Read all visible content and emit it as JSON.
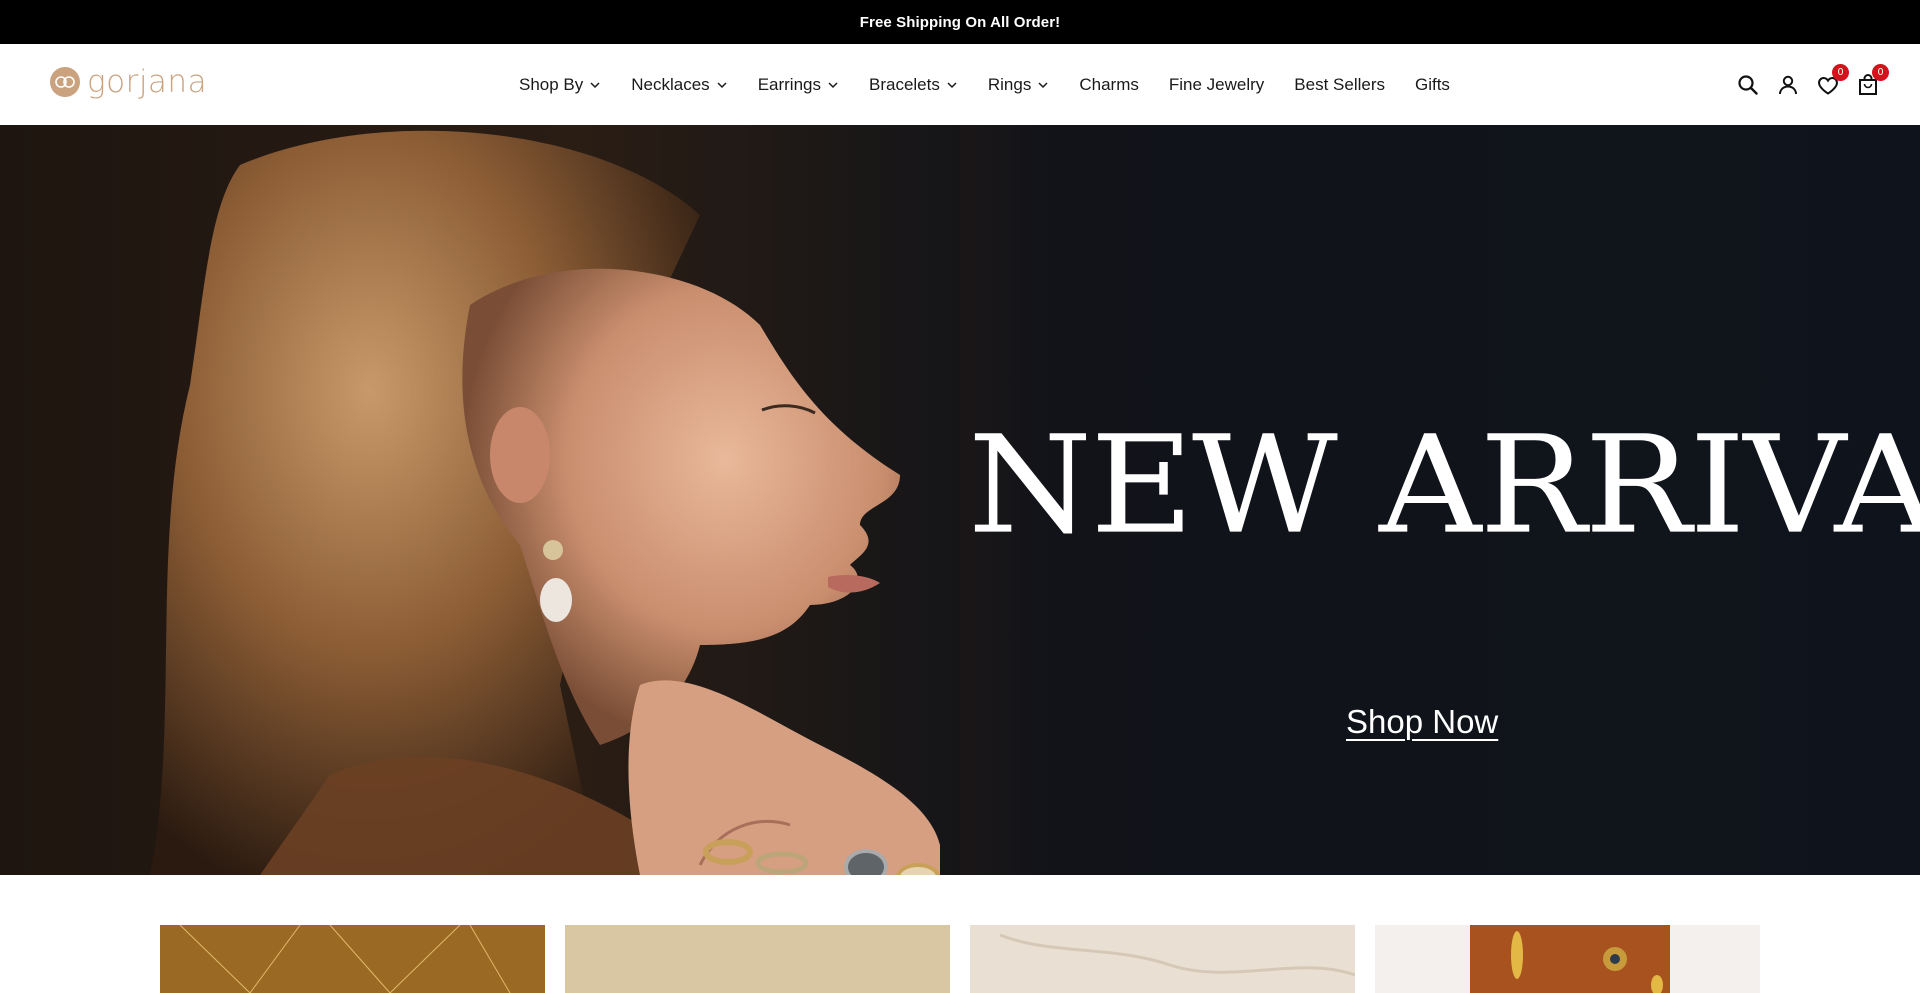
{
  "announcement": {
    "text": "Free Shipping On All Order!"
  },
  "brand": {
    "name": "gorjana",
    "color": "#caa27e"
  },
  "nav": {
    "items": [
      {
        "label": "Shop By",
        "has_dropdown": true
      },
      {
        "label": "Necklaces",
        "has_dropdown": true
      },
      {
        "label": "Earrings",
        "has_dropdown": true
      },
      {
        "label": "Bracelets",
        "has_dropdown": true
      },
      {
        "label": "Rings",
        "has_dropdown": true
      },
      {
        "label": "Charms",
        "has_dropdown": false
      },
      {
        "label": "Fine Jewelry",
        "has_dropdown": false
      },
      {
        "label": "Best Sellers",
        "has_dropdown": false
      },
      {
        "label": "Gifts",
        "has_dropdown": false
      }
    ]
  },
  "header_icons": {
    "search": "search-icon",
    "account": "user-icon",
    "wishlist": {
      "icon": "heart-icon",
      "count": "0"
    },
    "cart": {
      "icon": "bag-icon",
      "count": "0"
    },
    "badge_color": "#d6111e"
  },
  "hero": {
    "headline": "NEW ARRIVALS",
    "cta": "Shop Now"
  },
  "tiles": [
    {
      "name": "tile-necklaces"
    },
    {
      "name": "tile-earrings"
    },
    {
      "name": "tile-bracelets"
    },
    {
      "name": "tile-rings"
    }
  ]
}
